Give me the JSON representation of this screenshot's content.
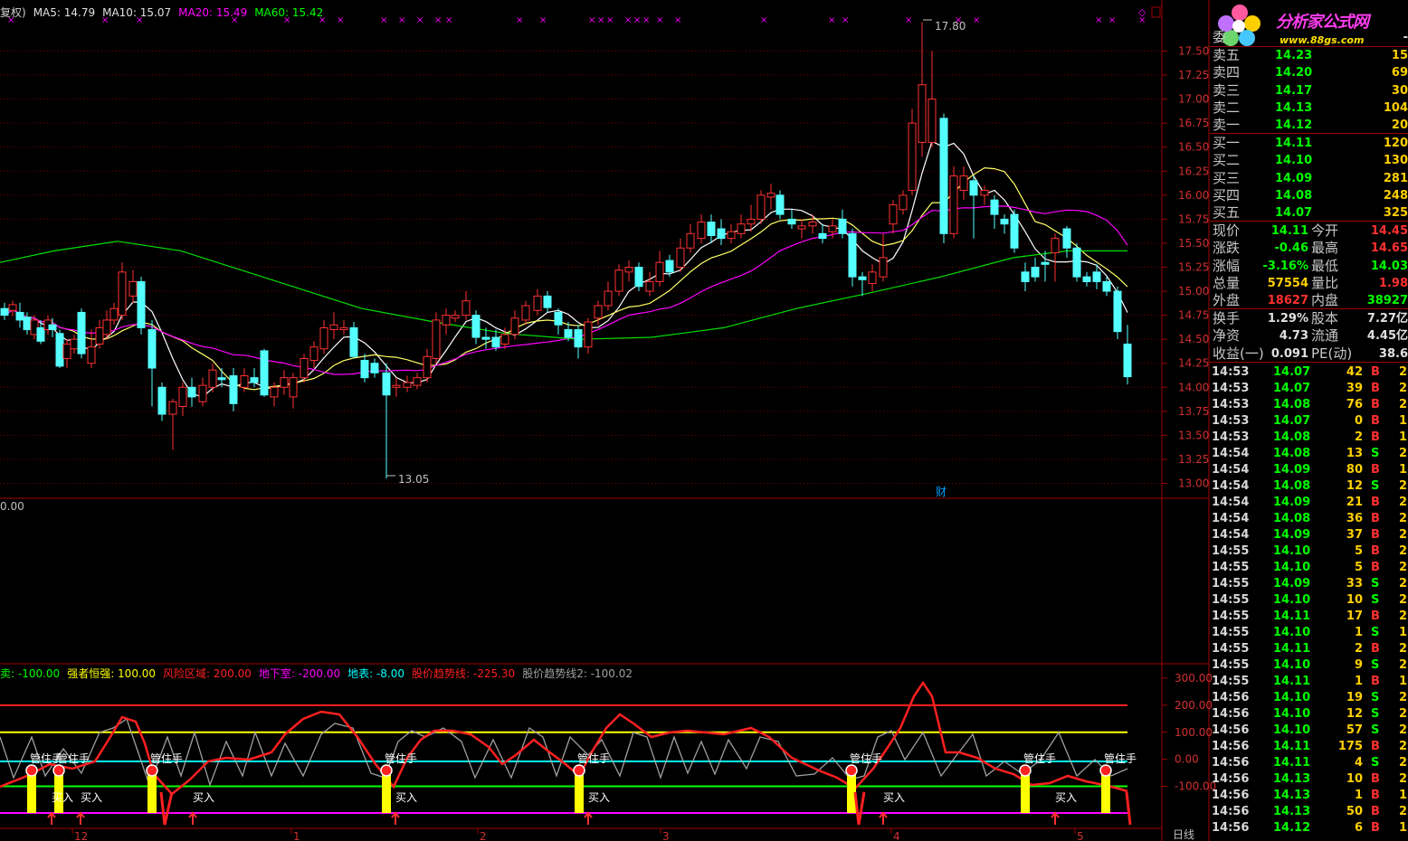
{
  "legend_top": [
    {
      "label": "复权)",
      "color": "#d0d0d0"
    },
    {
      "label": "MA5: 14.79",
      "color": "#e0e0e0"
    },
    {
      "label": "MA10: 15.07",
      "color": "#e0e0e0"
    },
    {
      "label": "MA20: 15.49",
      "color": "#ff00ff"
    },
    {
      "label": "MA60: 15.42",
      "color": "#00ff00"
    }
  ],
  "legend_bottom": [
    {
      "label": "卖: -100.00",
      "color": "#00ff00"
    },
    {
      "label": "强者恒强: 100.00",
      "color": "#ffff00"
    },
    {
      "label": "风险区域: 200.00",
      "color": "#ff2020"
    },
    {
      "label": "地下室: -200.00",
      "color": "#ff00ff"
    },
    {
      "label": "地表: -8.00",
      "color": "#00ffff"
    },
    {
      "label": "股价趋势线: -225.30",
      "color": "#ff2020"
    },
    {
      "label": "股价趋势线2: -100.02",
      "color": "#a0a0a0"
    }
  ],
  "mid_label": "0.00",
  "marker_labels": {
    "high": "17.80",
    "low": "13.05",
    "cai": "财",
    "hold": "管住手",
    "buy": "买入",
    "daily": "日线"
  },
  "x_axis": [
    {
      "label": "12",
      "x": 80
    },
    {
      "label": "1",
      "x": 322
    },
    {
      "label": "2",
      "x": 528
    },
    {
      "label": "3",
      "x": 730
    },
    {
      "label": "4",
      "x": 985
    },
    {
      "label": "5",
      "x": 1188
    }
  ],
  "price_axis": [
    "17.50",
    "17.25",
    "17.00",
    "16.75",
    "16.50",
    "16.25",
    "16.00",
    "15.75",
    "15.50",
    "15.25",
    "15.00",
    "14.75",
    "14.50",
    "14.25",
    "14.00",
    "13.75",
    "13.50",
    "13.25",
    "13.00"
  ],
  "osc_axis": [
    "300.00",
    "200.00",
    "100.00",
    "0.00",
    "-100.00"
  ],
  "chart_data": {
    "type": "candlestick",
    "ylim": [
      13.0,
      17.8
    ],
    "price_high": 17.8,
    "price_low": 13.05,
    "ma5": 14.79,
    "ma10": 15.07,
    "ma20": 15.49,
    "ma60": 15.42,
    "osc_ylim": [
      -200,
      300
    ],
    "osc_levels": {
      "risk": 200,
      "strong": 100,
      "surface": -8,
      "sell": -100,
      "basement": -200
    },
    "trend": -225.3,
    "trend2": -100.02
  },
  "logo": {
    "name": "分析家公式网",
    "url": "www.88gs.com"
  },
  "quote_header": {
    "label": "委",
    "value": "-"
  },
  "asks": [
    {
      "label": "卖五",
      "price": "14.23",
      "vol": "15"
    },
    {
      "label": "卖四",
      "price": "14.20",
      "vol": "69"
    },
    {
      "label": "卖三",
      "price": "14.17",
      "vol": "30"
    },
    {
      "label": "卖二",
      "price": "14.13",
      "vol": "104"
    },
    {
      "label": "卖一",
      "price": "14.12",
      "vol": "20"
    }
  ],
  "bids": [
    {
      "label": "买一",
      "price": "14.11",
      "vol": "120"
    },
    {
      "label": "买二",
      "price": "14.10",
      "vol": "130"
    },
    {
      "label": "买三",
      "price": "14.09",
      "vol": "281"
    },
    {
      "label": "买四",
      "price": "14.08",
      "vol": "248"
    },
    {
      "label": "买五",
      "price": "14.07",
      "vol": "325"
    }
  ],
  "stats": [
    {
      "l1": "现价",
      "v1": "14.11",
      "c1": "#00ff00",
      "l2": "今开",
      "v2": "14.45",
      "c2": "#ff3030"
    },
    {
      "l1": "涨跌",
      "v1": "-0.46",
      "c1": "#00ff00",
      "l2": "最高",
      "v2": "14.65",
      "c2": "#ff3030"
    },
    {
      "l1": "涨幅",
      "v1": "-3.16%",
      "c1": "#00ff00",
      "l2": "最低",
      "v2": "14.03",
      "c2": "#00ff00"
    },
    {
      "l1": "总量",
      "v1": "57554",
      "c1": "#ffd000",
      "l2": "量比",
      "v2": "1.98",
      "c2": "#ff3030"
    },
    {
      "l1": "外盘",
      "v1": "18627",
      "c1": "#ff3030",
      "l2": "内盘",
      "v2": "38927",
      "c2": "#00ff00"
    }
  ],
  "stats2": [
    {
      "l1": "换手",
      "v1": "1.29%",
      "c1": "#e0e0e0",
      "l2": "股本",
      "v2": "7.27亿",
      "c2": "#e0e0e0"
    },
    {
      "l1": "净资",
      "v1": "4.73",
      "c1": "#e0e0e0",
      "l2": "流通",
      "v2": "4.45亿",
      "c2": "#e0e0e0"
    },
    {
      "l1": "收益(一)",
      "v1": "0.091",
      "c1": "#e0e0e0",
      "l2": "PE(动)",
      "v2": "38.6",
      "c2": "#e0e0e0"
    }
  ],
  "ticks": [
    {
      "t": "14:53",
      "p": "14.07",
      "v": "42",
      "bs": "B",
      "n": "2"
    },
    {
      "t": "14:53",
      "p": "14.07",
      "v": "39",
      "bs": "B",
      "n": "2"
    },
    {
      "t": "14:53",
      "p": "14.08",
      "v": "76",
      "bs": "B",
      "n": "2"
    },
    {
      "t": "14:53",
      "p": "14.07",
      "v": "0",
      "bs": "B",
      "n": "1"
    },
    {
      "t": "14:53",
      "p": "14.08",
      "v": "2",
      "bs": "B",
      "n": "1"
    },
    {
      "t": "14:54",
      "p": "14.08",
      "v": "13",
      "bs": "S",
      "n": "2"
    },
    {
      "t": "14:54",
      "p": "14.09",
      "v": "80",
      "bs": "B",
      "n": "1"
    },
    {
      "t": "14:54",
      "p": "14.08",
      "v": "12",
      "bs": "S",
      "n": "2"
    },
    {
      "t": "14:54",
      "p": "14.09",
      "v": "21",
      "bs": "B",
      "n": "2"
    },
    {
      "t": "14:54",
      "p": "14.08",
      "v": "36",
      "bs": "B",
      "n": "2"
    },
    {
      "t": "14:54",
      "p": "14.09",
      "v": "37",
      "bs": "B",
      "n": "2"
    },
    {
      "t": "14:55",
      "p": "14.10",
      "v": "5",
      "bs": "B",
      "n": "2"
    },
    {
      "t": "14:55",
      "p": "14.10",
      "v": "5",
      "bs": "B",
      "n": "2"
    },
    {
      "t": "14:55",
      "p": "14.09",
      "v": "33",
      "bs": "S",
      "n": "2"
    },
    {
      "t": "14:55",
      "p": "14.10",
      "v": "10",
      "bs": "S",
      "n": "2"
    },
    {
      "t": "14:55",
      "p": "14.11",
      "v": "17",
      "bs": "B",
      "n": "2"
    },
    {
      "t": "14:55",
      "p": "14.10",
      "v": "1",
      "bs": "S",
      "n": "1"
    },
    {
      "t": "14:55",
      "p": "14.11",
      "v": "2",
      "bs": "B",
      "n": "2"
    },
    {
      "t": "14:55",
      "p": "14.10",
      "v": "9",
      "bs": "S",
      "n": "2"
    },
    {
      "t": "14:55",
      "p": "14.11",
      "v": "1",
      "bs": "B",
      "n": "1"
    },
    {
      "t": "14:56",
      "p": "14.10",
      "v": "19",
      "bs": "S",
      "n": "2"
    },
    {
      "t": "14:56",
      "p": "14.10",
      "v": "12",
      "bs": "S",
      "n": "2"
    },
    {
      "t": "14:56",
      "p": "14.10",
      "v": "57",
      "bs": "S",
      "n": "2"
    },
    {
      "t": "14:56",
      "p": "14.11",
      "v": "175",
      "bs": "B",
      "n": "2"
    },
    {
      "t": "14:56",
      "p": "14.11",
      "v": "4",
      "bs": "S",
      "n": "2"
    },
    {
      "t": "14:56",
      "p": "14.13",
      "v": "10",
      "bs": "B",
      "n": "2"
    },
    {
      "t": "14:56",
      "p": "14.13",
      "v": "1",
      "bs": "B",
      "n": "1"
    },
    {
      "t": "14:56",
      "p": "14.13",
      "v": "50",
      "bs": "B",
      "n": "2"
    },
    {
      "t": "14:56",
      "p": "14.12",
      "v": "6",
      "bs": "B",
      "n": "1"
    }
  ]
}
